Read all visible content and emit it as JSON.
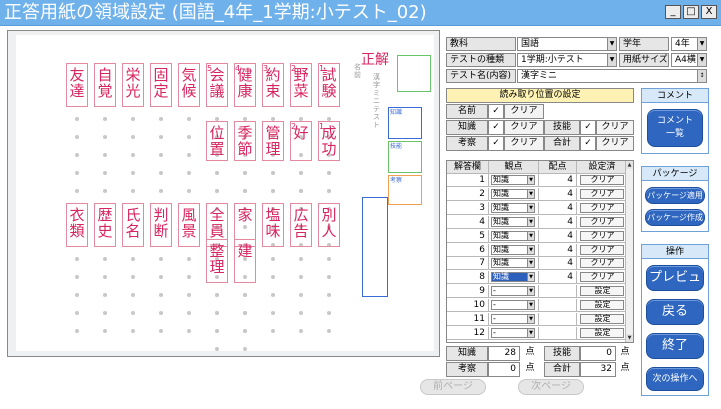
{
  "window": {
    "title": "正答用紙の領域設定 (国語_4年_1学期:小テスト_02)",
    "btn_minimize": "_",
    "btn_maximize": "□",
    "btn_close": "X"
  },
  "preview": {
    "corner_mark": "正解",
    "region_labels": [
      "知識",
      "技能",
      "考察"
    ],
    "sheet_title": "漢字ミニテスト",
    "name_label": "名前",
    "top_row": [
      {
        "num": "1",
        "answer": "試験"
      },
      {
        "num": "2",
        "answer": "野菜"
      },
      {
        "num": "3",
        "answer": "約束"
      },
      {
        "num": "4",
        "answer": "健康"
      },
      {
        "num": "5",
        "answer": "会議"
      },
      {
        "num": "",
        "answer": "気候"
      },
      {
        "num": "",
        "answer": "固定"
      },
      {
        "num": "",
        "answer": "栄光"
      },
      {
        "num": "",
        "answer": "自覚"
      },
      {
        "num": "",
        "answer": "友達"
      }
    ],
    "top_row2": [
      {
        "num": "1",
        "answer": "成功"
      },
      {
        "num": "2",
        "answer": "好"
      },
      {
        "num": "",
        "answer": "管理"
      },
      {
        "num": "",
        "answer": "季節"
      },
      {
        "num": "",
        "answer": "位置"
      }
    ],
    "bottom_row": [
      {
        "answer": "別人"
      },
      {
        "answer": "広告"
      },
      {
        "answer": "塩味"
      },
      {
        "answer": "家"
      },
      {
        "answer": "全員"
      },
      {
        "answer": "風景"
      },
      {
        "answer": "判断"
      },
      {
        "answer": "氏名"
      },
      {
        "answer": "歴史"
      },
      {
        "answer": "衣類"
      }
    ],
    "bottom_row2": [
      {
        "answer": "建"
      },
      {
        "answer": "整理"
      }
    ]
  },
  "nav": {
    "prev_page": "前ページ",
    "next_page": "次ページ"
  },
  "form": {
    "subject_label": "教科",
    "subject_value": "国語",
    "grade_label": "学年",
    "grade_value": "4年",
    "test_type_label": "テストの種類",
    "test_type_value": "1学期:小テスト",
    "paper_size_label": "用紙サイズ",
    "paper_size_value": "A4横",
    "test_name_label": "テスト名(内容)",
    "test_name_value": "漢字ミニ"
  },
  "read_pos": {
    "header": "読み取り位置の設定",
    "rows": [
      {
        "label": "名前",
        "check": "✓",
        "clear": "クリア"
      },
      {
        "label": "知識",
        "check": "✓",
        "clear": "クリア"
      },
      {
        "label": "考察",
        "check": "✓",
        "clear": "クリア"
      }
    ],
    "right_rows": [
      {
        "label": "技能",
        "check": "✓",
        "clear": "クリア"
      },
      {
        "label": "合計",
        "check": "✓",
        "clear": "クリア"
      }
    ]
  },
  "table": {
    "headers": [
      "解答欄",
      "観点",
      "配点",
      "設定済"
    ],
    "rows": [
      {
        "no": "1",
        "view": "知識",
        "points": "4",
        "status": "クリア",
        "highlight": false
      },
      {
        "no": "2",
        "view": "知識",
        "points": "4",
        "status": "クリア",
        "highlight": false
      },
      {
        "no": "3",
        "view": "知識",
        "points": "4",
        "status": "クリア",
        "highlight": false
      },
      {
        "no": "4",
        "view": "知識",
        "points": "4",
        "status": "クリア",
        "highlight": false
      },
      {
        "no": "5",
        "view": "知識",
        "points": "4",
        "status": "クリア",
        "highlight": false
      },
      {
        "no": "6",
        "view": "知識",
        "points": "4",
        "status": "クリア",
        "highlight": false
      },
      {
        "no": "7",
        "view": "知識",
        "points": "4",
        "status": "クリア",
        "highlight": false
      },
      {
        "no": "8",
        "view": "知識",
        "points": "4",
        "status": "クリア",
        "highlight": true
      },
      {
        "no": "9",
        "view": "-",
        "points": "",
        "status": "設定",
        "highlight": false
      },
      {
        "no": "10",
        "view": "-",
        "points": "",
        "status": "設定",
        "highlight": false
      },
      {
        "no": "11",
        "view": "-",
        "points": "",
        "status": "設定",
        "highlight": false
      },
      {
        "no": "12",
        "view": "-",
        "points": "",
        "status": "設定",
        "highlight": false
      }
    ]
  },
  "totals": {
    "knowledge_label": "知識",
    "knowledge_value": "28",
    "knowledge_unit": "点",
    "skill_label": "技能",
    "skill_value": "0",
    "skill_unit": "点",
    "thought_label": "考察",
    "thought_value": "0",
    "thought_unit": "点",
    "sum_label": "合計",
    "sum_value": "32",
    "sum_unit": "点"
  },
  "comment_group": {
    "header": "コメント",
    "list_button_line1": "コメント",
    "list_button_line2": "一覧"
  },
  "package_group": {
    "header": "パッケージ",
    "apply_button": "パッケージ適用",
    "create_button": "パッケージ作成"
  },
  "ops_group": {
    "header": "操作",
    "preview_button": "プレビュー",
    "back_button": "戻る",
    "finish_button": "終了",
    "next_op_button": "次の操作へ"
  },
  "colors": {
    "titlebar": "#6fb1ea",
    "accent_blue": "#2e66c0",
    "answer_pink": "#d8245f",
    "section_yellow": "#fdf2b3"
  }
}
